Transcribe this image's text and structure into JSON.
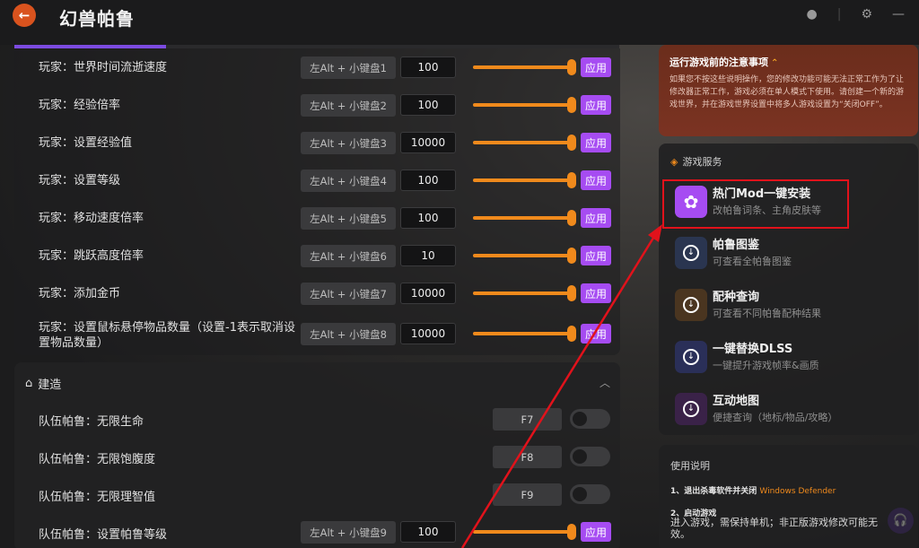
{
  "app": {
    "title": "幻兽帕鲁",
    "progress_pct": 25
  },
  "settings_rows": [
    {
      "label": "玩家：世界时间流逝速度",
      "hotkey": "左Alt + 小键盘1",
      "value": "100",
      "apply": "应用"
    },
    {
      "label": "玩家：经验倍率",
      "hotkey": "左Alt + 小键盘2",
      "value": "100",
      "apply": "应用"
    },
    {
      "label": "玩家：设置经验值",
      "hotkey": "左Alt + 小键盘3",
      "value": "10000",
      "apply": "应用"
    },
    {
      "label": "玩家：设置等级",
      "hotkey": "左Alt + 小键盘4",
      "value": "100",
      "apply": "应用"
    },
    {
      "label": "玩家：移动速度倍率",
      "hotkey": "左Alt + 小键盘5",
      "value": "100",
      "apply": "应用"
    },
    {
      "label": "玩家：跳跃高度倍率",
      "hotkey": "左Alt + 小键盘6",
      "value": "10",
      "apply": "应用"
    },
    {
      "label": "玩家：添加金币",
      "hotkey": "左Alt + 小键盘7",
      "value": "10000",
      "apply": "应用"
    },
    {
      "label": "玩家：设置鼠标悬停物品数量（设置-1表示取消设置物品数量）",
      "hotkey": "左Alt + 小键盘8",
      "value": "10000",
      "apply": "应用"
    }
  ],
  "build_section": {
    "title": "建造",
    "toggle_rows": [
      {
        "label": "队伍帕鲁：无限生命",
        "key": "F7"
      },
      {
        "label": "队伍帕鲁：无限饱腹度",
        "key": "F8"
      },
      {
        "label": "队伍帕鲁：无限理智值",
        "key": "F9"
      }
    ],
    "slider_row": {
      "label": "队伍帕鲁：设置帕鲁等级",
      "hotkey": "左Alt + 小键盘9",
      "value": "100",
      "apply": "应用"
    }
  },
  "notice": {
    "title": "运行游戏前的注意事项",
    "body": "如果您不按这些说明操作，您的修改功能可能无法正常工作为了让修改器正常工作，游戏必须在单人模式下使用。请创建一个新的游戏世界，并在游戏世界设置中将多人游戏设置为“关闭OFF”。"
  },
  "services": {
    "title": "游戏服务",
    "items": [
      {
        "name": "热门Mod一键安装",
        "desc": "改帕鲁词条、主角皮肤等",
        "color": "#a64cf2"
      },
      {
        "name": "帕鲁图鉴",
        "desc": "可查看全帕鲁图鉴",
        "color": "#2a3550"
      },
      {
        "name": "配种查询",
        "desc": "可查看不同帕鲁配种结果",
        "color": "#4a3520"
      },
      {
        "name": "一键替换DLSS",
        "desc": "一键提升游戏帧率&画质",
        "color": "#2a2f58"
      },
      {
        "name": "互动地图",
        "desc": "便捷查询（地标/物品/攻略）",
        "color": "#3a2248"
      }
    ]
  },
  "usage": {
    "title": "使用说明",
    "step1_prefix": "1、退出杀毒软件并关闭",
    "step1_highlight": "Windows Defender",
    "step2_title": "2、启动游戏",
    "step2_body": "进入游戏，需保持单机；非正版游戏修改可能无效。"
  },
  "colors": {
    "accent_purple": "#a64cf2",
    "accent_orange": "#f08a1c",
    "highlight_red": "#e1121b"
  }
}
